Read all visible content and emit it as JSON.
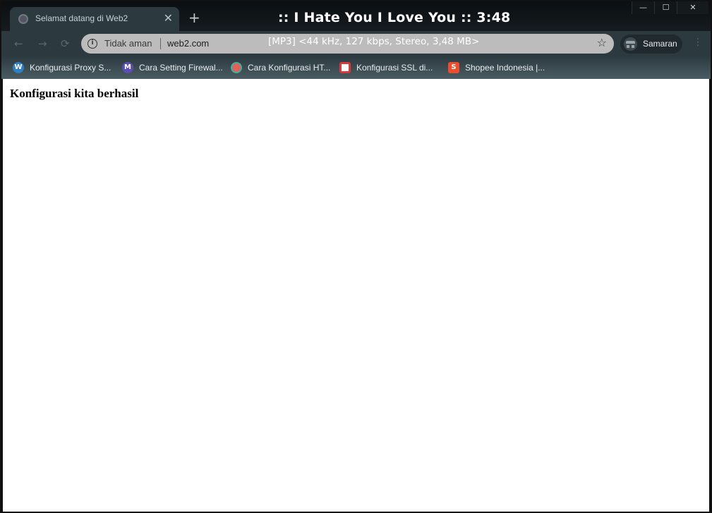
{
  "tab": {
    "title": "Selamat datang di Web2",
    "close": "✕"
  },
  "new_tab": "+",
  "media_overlay": {
    "title": ":: I Hate You I Love You :: 3:48",
    "info": "[MP3] <44 kHz, 127 kbps, Stereo, 3,48 MB>"
  },
  "window_controls": {
    "minimize": "—",
    "maximize": "☐",
    "close": "✕"
  },
  "toolbar": {
    "back": "←",
    "forward": "→",
    "reload": "⟳",
    "security_label": "Tidak aman",
    "url": "web2.com",
    "bookmark_star": "☆",
    "profile_label": "Samaran",
    "menu": "⋮"
  },
  "bookmarks": [
    {
      "label": "Konfigurasi Proxy S...",
      "icon": "wordpress-icon",
      "icon_glyph": "W",
      "color": "#2f7fc1"
    },
    {
      "label": "Cara Setting Firewal...",
      "icon": "mikrotik-icon",
      "icon_glyph": "M",
      "color": "#5b4fb3"
    },
    {
      "label": "Cara Konfigurasi HT...",
      "icon": "site-icon",
      "icon_glyph": "",
      "color": "#e0615a"
    },
    {
      "label": "Konfigurasi SSL di...",
      "icon": "site-icon",
      "icon_glyph": "",
      "color": "#d63a3a"
    },
    {
      "label": "Shopee Indonesia |...",
      "icon": "shopee-icon",
      "icon_glyph": "S",
      "color": "#ee4d2d"
    }
  ],
  "page": {
    "heading": "Konfigurasi kita berhasil"
  }
}
